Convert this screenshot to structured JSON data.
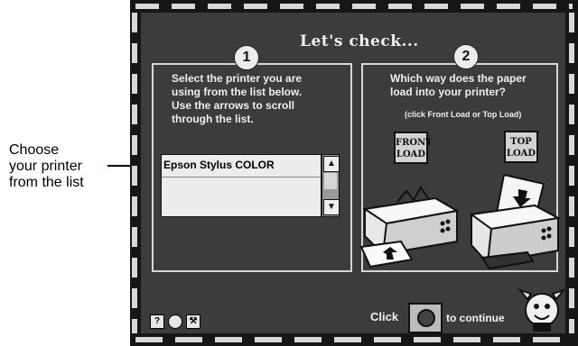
{
  "callout": {
    "lines": [
      "Choose",
      "your printer",
      "from the list"
    ]
  },
  "dialog": {
    "title": "Let's check...",
    "step1": {
      "number": "1",
      "instructions": [
        "Select the printer you are",
        "using from the list below.",
        "Use the arrows to scroll",
        "through the list."
      ],
      "printers": [
        "Epson Stylus COLOR"
      ],
      "scroll_up_icon": "arrow-up-icon",
      "scroll_down_icon": "arrow-down-icon"
    },
    "step2": {
      "number": "2",
      "question": [
        "Which way does the paper",
        "load into your printer?"
      ],
      "hint": "(click Front Load or Top Load)",
      "front_load": [
        "FRONT",
        "LOAD"
      ],
      "top_load": [
        "TOP",
        "LOAD"
      ]
    },
    "footer": {
      "click_label": "Click",
      "continue_label": "to continue",
      "help_icon": "?",
      "tools_icon": "wrench-icon"
    }
  }
}
